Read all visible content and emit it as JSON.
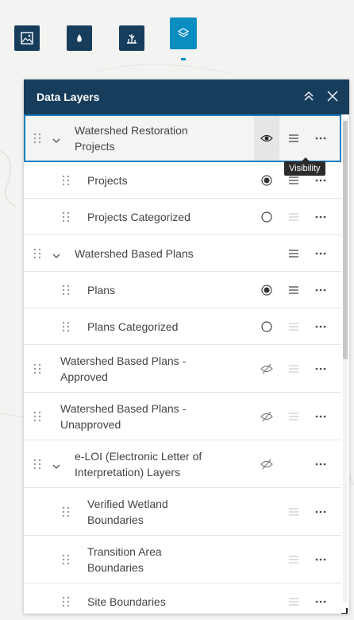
{
  "widgets": [
    {
      "name": "basemap-gallery-icon"
    },
    {
      "name": "water-drop-icon"
    },
    {
      "name": "wetland-icon"
    },
    {
      "name": "layers-icon"
    }
  ],
  "panel": {
    "title": "Data Layers",
    "tooltip": "Visibility"
  },
  "layers": [
    {
      "label_line1": "Watershed Restoration",
      "label_line2": "Projects",
      "visibility": "visible"
    },
    {
      "label": "Projects",
      "visibility": "on"
    },
    {
      "label": "Projects Categorized",
      "visibility": "off"
    },
    {
      "label": "Watershed Based Plans",
      "visibility": "none"
    },
    {
      "label": "Plans",
      "visibility": "on"
    },
    {
      "label": "Plans Categorized",
      "visibility": "off"
    },
    {
      "label_line1": "Watershed Based Plans -",
      "label_line2": "Approved",
      "visibility": "hidden"
    },
    {
      "label_line1": "Watershed Based Plans -",
      "label_line2": "Unapproved",
      "visibility": "hidden"
    },
    {
      "label_line1": "e-LOI (Electronic Letter of",
      "label_line2": "Interpretation) Layers",
      "visibility": "hidden"
    },
    {
      "label_line1": "Verified Wetland",
      "label_line2": "Boundaries",
      "visibility": "none"
    },
    {
      "label_line1": "Transition Area",
      "label_line2": "Boundaries",
      "visibility": "none"
    },
    {
      "label": "Site Boundaries",
      "visibility": "none"
    }
  ],
  "colors": {
    "header": "#173d5c",
    "accent": "#0a8ec2",
    "selection": "#1a7fc2"
  }
}
